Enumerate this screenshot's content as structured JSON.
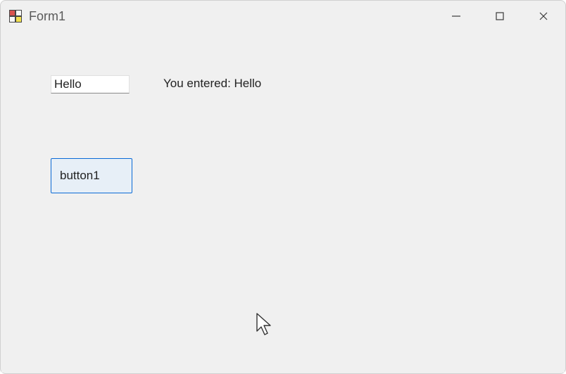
{
  "window": {
    "title": "Form1"
  },
  "textbox": {
    "value": "Hello"
  },
  "label": {
    "text": "You entered: Hello"
  },
  "button": {
    "label": "button1"
  }
}
